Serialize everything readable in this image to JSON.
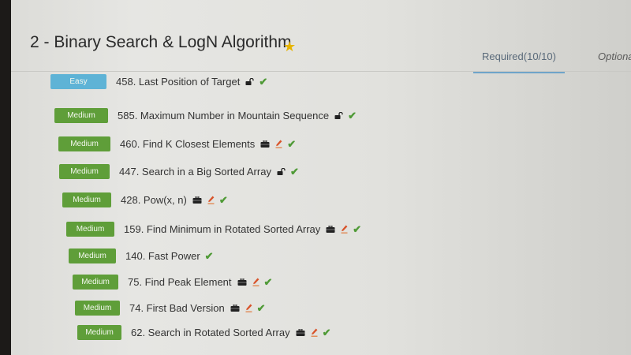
{
  "section": {
    "title": "2 - Binary Search & LogN Algorithm",
    "star_icon": "star-icon"
  },
  "tabs": [
    {
      "label": "Required(10/10)",
      "active": true
    },
    {
      "label": "Optiona",
      "active": false
    }
  ],
  "colors": {
    "easy_badge": "#5eb3d6",
    "medium_badge": "#5f9e39",
    "check": "#4f9a36",
    "active_tab_underline": "#6fa4c9",
    "star": "#e6b400"
  },
  "problems": [
    {
      "difficulty": "Easy",
      "title": "458. Last Position of Target",
      "icons": [
        "lock-icon",
        "check-icon"
      ]
    },
    {
      "difficulty": "Medium",
      "title": "585. Maximum Number in Mountain Sequence",
      "icons": [
        "lock-icon",
        "check-icon"
      ]
    },
    {
      "difficulty": "Medium",
      "title": "460. Find K Closest Elements",
      "icons": [
        "briefcase-icon",
        "pen-icon",
        "check-icon"
      ]
    },
    {
      "difficulty": "Medium",
      "title": "447. Search in a Big Sorted Array",
      "icons": [
        "lock-icon",
        "check-icon"
      ]
    },
    {
      "difficulty": "Medium",
      "title": "428. Pow(x, n)",
      "icons": [
        "briefcase-icon",
        "pen-icon",
        "check-icon"
      ]
    },
    {
      "difficulty": "Medium",
      "title": "159. Find Minimum in Rotated Sorted Array",
      "icons": [
        "briefcase-icon",
        "pen-icon",
        "check-icon"
      ]
    },
    {
      "difficulty": "Medium",
      "title": "140. Fast Power",
      "icons": [
        "check-icon"
      ]
    },
    {
      "difficulty": "Medium",
      "title": "75. Find Peak Element",
      "icons": [
        "briefcase-icon",
        "pen-icon",
        "check-icon"
      ]
    },
    {
      "difficulty": "Medium",
      "title": "74. First Bad Version",
      "icons": [
        "briefcase-icon",
        "pen-icon",
        "check-icon"
      ]
    },
    {
      "difficulty": "Medium",
      "title": "62. Search in Rotated Sorted Array",
      "icons": [
        "briefcase-icon",
        "pen-icon",
        "check-icon"
      ]
    }
  ]
}
